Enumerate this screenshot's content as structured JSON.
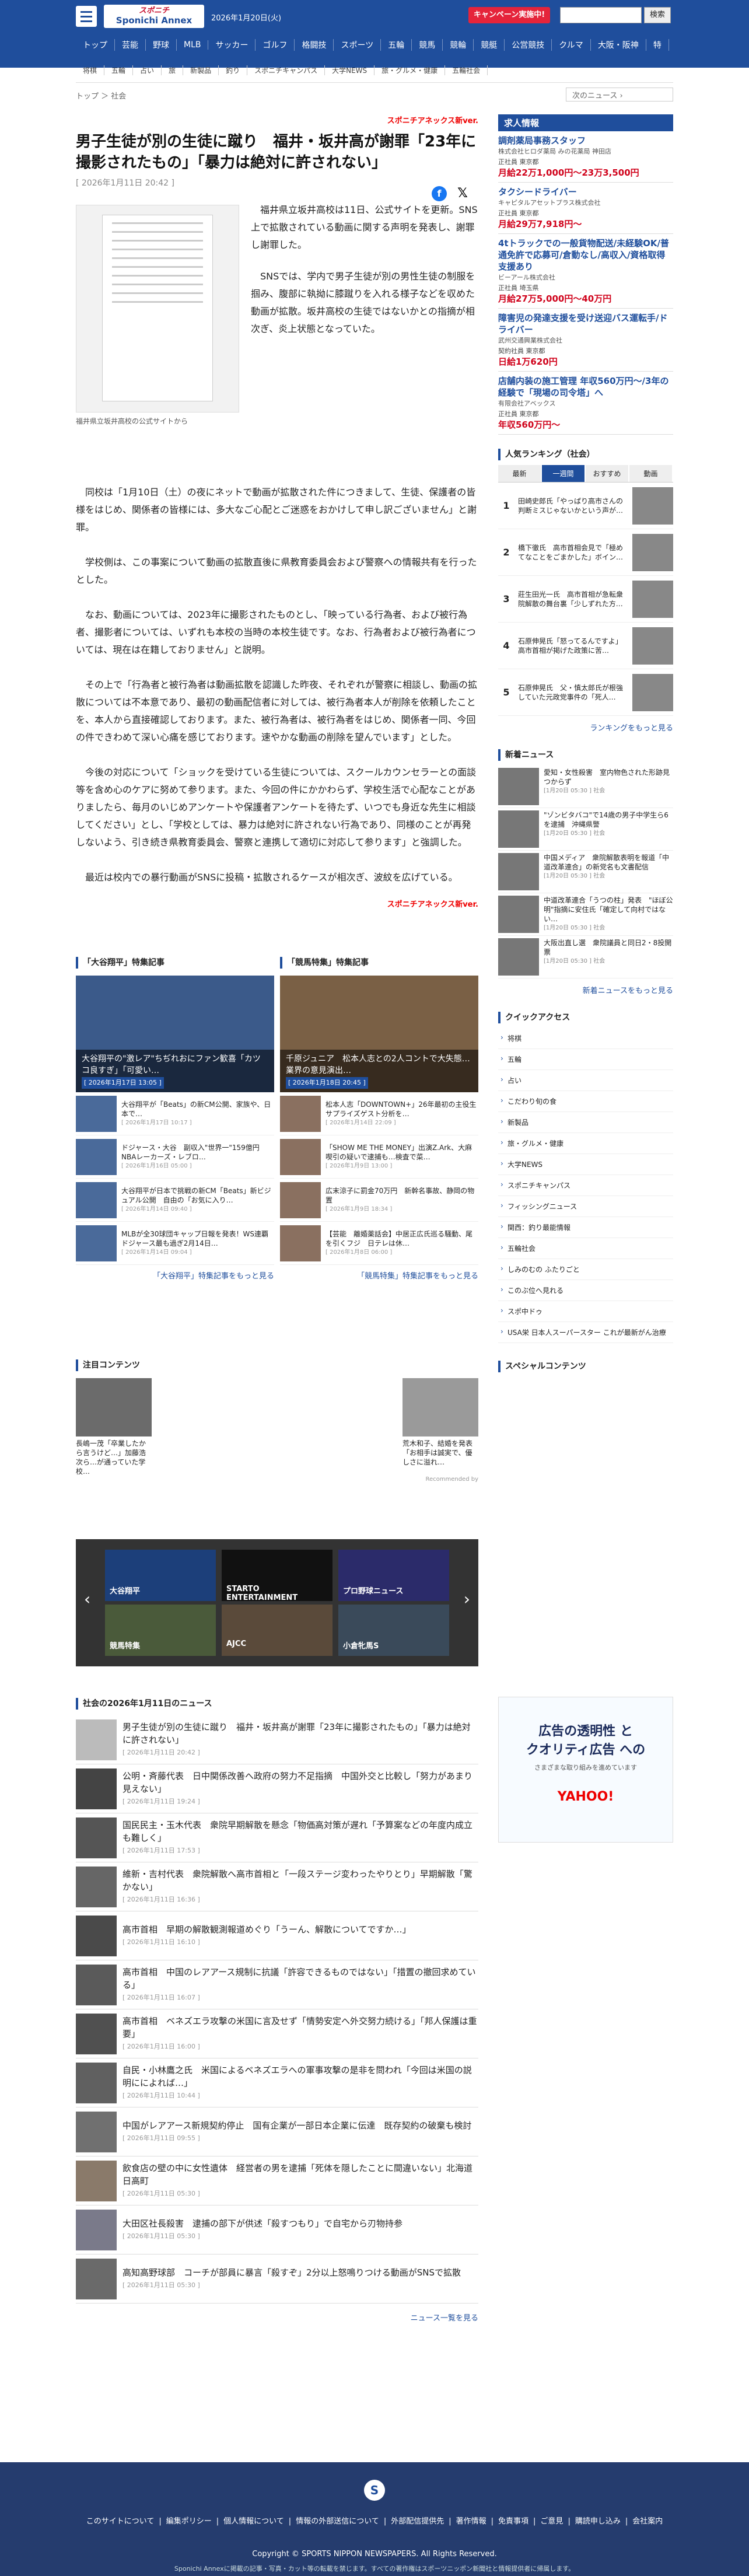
{
  "header": {
    "logo_top": "スポニチ",
    "logo_bottom": "Sponichi Annex",
    "date": "2026年1月20日(火)",
    "campaign": "キャンペーン実施中!",
    "search_button": "検索",
    "search_placeholder": "",
    "nav": [
      "トップ",
      "芸能",
      "野球",
      "MLB",
      "サッカー",
      "ゴルフ",
      "格闘技",
      "スポーツ",
      "五輪",
      "競馬",
      "競輪",
      "競艇",
      "公営競技",
      "クルマ",
      "大阪・阪神",
      "特"
    ],
    "subnav": [
      "将棋",
      "五輪",
      "占い",
      "旅",
      "新製品",
      "釣り",
      "スポニチキャンパス",
      "大学NEWS",
      "旅・グルメ・健康",
      "五輪社会"
    ]
  },
  "breadcrumb": {
    "items": [
      "トップ",
      "社会"
    ],
    "next": "次のニュース"
  },
  "article": {
    "byline": "スポニチアネックス新ver.",
    "title": "男子生徒が別の生徒に蹴り　福井・坂井高が謝罪「23年に撮影されたもの」「暴力は絶対に許されない」",
    "date": "[ 2026年1月11日 20:42 ]",
    "photo_caption": "福井県立坂井高校の公式サイトから",
    "p1": "福井県立坂井高校は11日、公式サイトを更新。SNS上で拡散されている動画に関する声明を発表し、謝罪し謝罪した。",
    "p2": "SNSでは、学内で男子生徒が別の男性生徒の制服を掴み、腹部に執拗に膝蹴りを入れる様子などを収めた動画が拡散。坂井高校の生徒ではないかとの指摘が相次ぎ、炎上状態となっていた。",
    "p3": "同校は「1月10日（土）の夜にネットで動画が拡散された件につきまして、生徒、保護者の皆様をはじめ、関係者の皆様には、多大なご心配とご迷惑をおかけして申し訳ございません」と謝罪。",
    "p4": "学校側は、この事案について動画の拡散直後に県教育委員会および警察への情報共有を行ったとした。",
    "p5": "なお、動画については、2023年に撮影されたものとし、「映っている行為者、および被行為者、撮影者については、いずれも本校の当時の本校生徒です。なお、行為者および被行為者については、現在は在籍しておりません」と説明。",
    "p6": "その上で「行為者と被行為者は動画拡散を認識した昨夜、それぞれが警察に相談し、動画の拡散については不本意であり、最初の動画配信者に対しては、被行為者本人が削除を依頼したことを、本人から直接確認しております。また、被行為者は、被行為者をはじめ、関係者一同、今回の件できわめて深い心痛を感じております。速やかな動画の削除を望んでいます」とした。",
    "p7": "今後の対応について「ショックを受けている生徒については、スクールカウンセラーとの面談等を含め心のケアに努めて参ります。また、今回の件にかかわらず、学校生活で心配なことがありましたら、毎月のいじめアンケートや保護者アンケートを待たず、いつでも身近な先生に相談してください」とし、「学校としては、暴力は絶対に許されない行為であり、同様のことが再発しないよう、引き続き県教育委員会、警察と連携して適切に対応して参ります」と強調した。",
    "p8": "最近は校内での暴行動画がSNSに投稿・拡散されるケースが相次ぎ、波紋を広げている。",
    "footer_byline": "スポニチアネックス新ver."
  },
  "features": {
    "left": {
      "title": "「大谷翔平」特集記事",
      "big_caption": "大谷翔平の\"激レア\"ちぢれおにファン歓喜「カツコ良すぎ」「可愛い…",
      "big_date": "[ 2026年1月17日 13:05 ]",
      "items": [
        {
          "t": "大谷翔平が「Beats」の新CM公開、家族や、日本で…",
          "d": "[ 2026年1月17日 10:17 ]"
        },
        {
          "t": "ドジャース・大谷　副収入\"世界一\"159億円　NBAレーカーズ・レブロ…",
          "d": "[ 2026年1月16日 05:00 ]"
        },
        {
          "t": "大谷翔平が日本で挑戦の新CM「Beats」新ビジュアル公開　自由の「お気に入り…",
          "d": "[ 2026年1月14日 09:40 ]"
        },
        {
          "t": "MLBが全30球団キャップ日報を発表！WS連覇ドジャース最も過ぎ2月14日…",
          "d": "[ 2026年1月14日 09:04 ]"
        }
      ],
      "more": "「大谷翔平」特集記事をもっと見る"
    },
    "right": {
      "title": "「競馬特集」特集記事",
      "big_caption": "千原ジュニア　松本人志との2人コントで大失態…業界の意見演出…",
      "big_date": "[ 2026年1月18日 20:45 ]",
      "items": [
        {
          "t": "松本人志「DOWNTOWN+」26年最初の主役生　サプライズゲスト分析を…",
          "d": "[ 2026年1月14日 22:09 ]"
        },
        {
          "t": "「SHOW ME THE MONEY」出演Z.Ark、大麻喫引の疑いで逮捕も…検査で菜…",
          "d": "[ 2026年1月9日 13:00 ]"
        },
        {
          "t": "広末涼子に罰金70万円　新幹名事故、静岡の物置",
          "d": "[ 2026年1月9日 18:34 ]"
        },
        {
          "t": "【芸能　離婚薬話会】中居正広氏巡る騒動、尾を引くフジ　日テレは休…",
          "d": "[ 2026年1月8日 06:00 ]"
        }
      ],
      "more": "「競馬特集」特集記事をもっと見る"
    }
  },
  "attention": {
    "title": "注目コンテンツ",
    "items": [
      {
        "t": "長嶋一茂「卒業したから言うけど…」加藤浩次ら…が通っていた学校…"
      },
      {
        "t": "荒木和子、結婚を発表「お相手は誠実で、優しさに溢れ…"
      }
    ],
    "credit": "Recommended by"
  },
  "carousel": {
    "tiles": [
      "大谷翔平",
      "STARTO ENTERTAINMENT",
      "プロ野球ニュース",
      "競馬特集",
      "AJCC",
      "小倉牝馬S"
    ]
  },
  "newslist": {
    "title": "社会の2026年1月11日のニュース",
    "items": [
      {
        "t": "男子生徒が別の生徒に蹴り　福井・坂井高が謝罪「23年に撮影されたもの」「暴力は絶対に許されない」",
        "d": "[ 2026年1月11日 20:42 ]"
      },
      {
        "t": "公明・斉藤代表　日中関係改善へ政府の努力不足指摘　中国外交と比較し「努力があまり見えない」",
        "d": "[ 2026年1月11日 19:24 ]"
      },
      {
        "t": "国民民主・玉木代表　衆院早期解散を懸念「物価高対策が遅れ「予算案などの年度内成立も難しく」",
        "d": "[ 2026年1月11日 17:53 ]"
      },
      {
        "t": "維新・吉村代表　衆院解散へ高市首相と「一段ステージ変わったやりとり」早期解散「驚かない」",
        "d": "[ 2026年1月11日 16:36 ]"
      },
      {
        "t": "高市首相　早期の解散観測報道めぐり「うーん、解散についてですか…」",
        "d": "[ 2026年1月11日 16:10 ]"
      },
      {
        "t": "高市首相　中国のレアアース規制に抗議「許容できるものではない」「措置の撤回求めている」",
        "d": "[ 2026年1月11日 16:07 ]"
      },
      {
        "t": "高市首相　ベネズエラ攻撃の米国に言及せず「情勢安定へ外交努力続ける」「邦人保護は重要」",
        "d": "[ 2026年1月11日 16:00 ]"
      },
      {
        "t": "自民・小林鷹之氏　米国によるベネズエラへの軍事攻撃の是非を問われ「今回は米国の説明にによれば…」",
        "d": "[ 2026年1月11日 10:44 ]"
      },
      {
        "t": "中国がレアアース新規契約停止　国有企業が一部日本企業に伝達　既存契約の破棄も検討",
        "d": "[ 2026年1月11日 09:55 ]"
      },
      {
        "t": "飲食店の壁の中に女性遺体　経営者の男を逮捕「死体を隠したことに間違いない」北海道日高町",
        "d": "[ 2026年1月11日 05:30 ]"
      },
      {
        "t": "大田区社長殺害　逮捕の部下が供述「殺すつもり」で自宅から刃物持参",
        "d": "[ 2026年1月11日 05:30 ]"
      },
      {
        "t": "高知高野球部　コーチが部員に暴言「殺すぞ」2分以上怒鳴りつける動画がSNSで拡散",
        "d": "[ 2026年1月11日 05:30 ]"
      }
    ],
    "more": "ニュース一覧を見る"
  },
  "side": {
    "jobs_title": "求人情報",
    "jobs": [
      {
        "t": "調剤薬局事務スタッフ",
        "c": "株式会社ヒロダ薬局 みの花薬局 神田店",
        "tags": "正社員 東京都",
        "s": "月給22万1,000円〜23万3,500円"
      },
      {
        "t": "タクシードライバー",
        "c": "キャピタルアセットプラス株式会社",
        "tags": "正社員 東京都",
        "s": "月給29万7,918円〜"
      },
      {
        "t": "4tトラックでの一般貨物配送/未経験OK/普通免許で応募可/倉動なし/高収入/資格取得支援あり",
        "c": "ビーアール株式会社",
        "tags": "正社員 埼玉県",
        "s": "月給27万5,000円〜40万円"
      },
      {
        "t": "障害児の発達支援を受け送迎バス運転手/ドライバー",
        "c": "武州交通興業株式会社",
        "tags": "契約社員 東京都",
        "s": "日給1万620円"
      },
      {
        "t": "店舗内装の施工管理 年収560万円〜/3年の経験で「現場の司令塔」へ",
        "c": "有限会社アベックス",
        "tags": "正社員 東京都",
        "s": "年収560万円〜"
      }
    ],
    "ranking_title": "人気ランキング（社会）",
    "ranking_tabs": [
      "最新",
      "一週間",
      "おすすめ",
      "動画"
    ],
    "ranking": [
      {
        "n": "1",
        "t": "田崎史郎氏「やっぱり高市さんの判断ミスじゃないかという声が…"
      },
      {
        "n": "2",
        "t": "橋下徹氏　高市首相会見で「極めてなことをごまかした」ボイン…"
      },
      {
        "n": "3",
        "t": "莊生田光一氏　高市首相が急転衆院解散の舞台裏「少しずれた方…"
      },
      {
        "n": "4",
        "t": "石原伸晃氏「怒ってるんですよ」　高市首相が掲げた政策に苦…"
      },
      {
        "n": "5",
        "t": "石原伸晃氏　父・慎太郎氏が根強していた元政党事件の「死人…"
      }
    ],
    "ranking_more": "ランキングをもっと見る",
    "news_title": "新着ニュース",
    "news": [
      {
        "t": "愛知・女性殺害　室内物色された形跡見つからず",
        "d": "[1月20日 05:30 ] 社会"
      },
      {
        "t": "\"ゾンビタバコ\"で14歳の男子中学生ら6を逮捕　沖縄県警",
        "d": "[1月20日 05:30 ] 社会"
      },
      {
        "t": "中国メディア　衆院解散表明を報道「中道改革連合」の新党名も文書配信",
        "d": "[1月20日 05:30 ] 社会"
      },
      {
        "t": "中道改革連合「うつの柱」発表　\"ほぼ公明\"指摘に安住氏「確定して向村ではない…",
        "d": "[1月20日 05:30 ] 社会"
      },
      {
        "t": "大阪出直し選　衆院議員と同日2・8投開票",
        "d": "[1月20日 05:30 ] 社会"
      }
    ],
    "news_more": "新着ニュースをもっと見る",
    "quick_title": "クイックアクセス",
    "quick": [
      "将棋",
      "五輪",
      "占い",
      "こだわり旬の食",
      "新製品",
      "旅・グルメ・健康",
      "大学NEWS",
      "スポニチキャンパス",
      "フィッシングニュース",
      "関西：釣り最能情報",
      "五輪社会",
      "しみのむの ふたりごと",
      "このぶ位へ見れる",
      "スポ中ドゥ",
      "USA栄 日本人スーパースター これが最新がん治療"
    ],
    "special_title": "スペシャルコンテンツ",
    "ad_line1": "広告の透明性 と",
    "ad_line2": "クオリティ広告 への",
    "ad_line3": "さまざまな取り組みを進めています",
    "ad_brand": "YAHOO!"
  },
  "footer": {
    "links": [
      "このサイトについて",
      "編集ポリシー",
      "個人情報について",
      "情報の外部送信について",
      "外部配信提供先",
      "著作情報",
      "免責事項",
      "ご意見",
      "購読申し込み",
      "会社案内"
    ],
    "copyright": "Copyright © SPORTS NIPPON NEWSPAPERS. All Rights Reserved.",
    "copyright2": "Sponichi Annexに掲載の記事・写真・カット等の転載を禁じます。すべての著作権はスポーツニッポン新聞社と情報提供者に帰属します。"
  },
  "colors": {
    "brand": "#1f4e9c",
    "accent": "#e5243b"
  }
}
